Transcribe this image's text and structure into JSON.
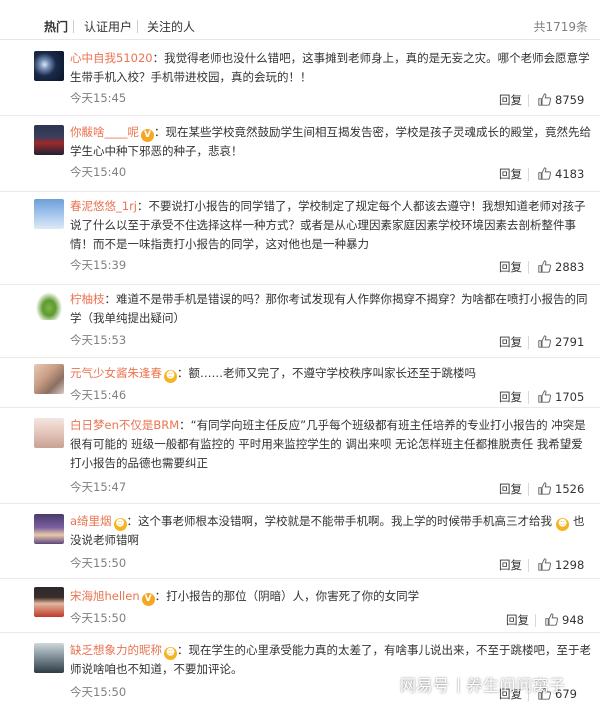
{
  "tabs": [
    {
      "label": "热门"
    },
    {
      "label": "认证用户"
    },
    {
      "label": "关注的人"
    }
  ],
  "total_label": "共1719条",
  "reply_label": "回复",
  "comments": [
    {
      "user": "心中自我51020",
      "text": "：我觉得老师也没什么错吧，这事摊到老师身上，真的是无妄之灾。哪个老师会愿意学生带手机入校？手机带进校园，真的会玩的！！",
      "time": "今天15:45",
      "likes": "8759"
    },
    {
      "user": "你黻啥____呢",
      "text": "：现在某些学校竟然鼓励学生间相互揭发告密，学校是孩子灵魂成长的殿堂，竟然先给学生心中种下邪恶的种子，悲哀！",
      "time": "今天15:40",
      "likes": "4183"
    },
    {
      "user": "春泥悠悠_1rj",
      "text": "：不要说打小报告的同学错了，学校制定了规定每个人都该去遵守！我想知道老师对孩子说了什么以至于承受不住选择这样一种方式？或者是从心理因素家庭因素学校环境因素去剖析整件事情！而不是一味指责打小报告的同学，这对他也是一种暴力",
      "time": "今天15:39",
      "likes": "2883"
    },
    {
      "user": "柠柚枝",
      "text": "：难道不是带手机是错误的吗？那你考试发现有人作弊你揭穿不揭穿？为啥都在喷打小报告的同学（我单纯提出疑问）",
      "time": "今天15:53",
      "likes": "2791"
    },
    {
      "user": "元气少女酱朱逢春",
      "text": "：额……老师又完了，不遵守学校秩序叫家长还至于跳楼吗",
      "time": "今天15:46",
      "likes": "1705"
    },
    {
      "user": "白日梦en不仅是BRM",
      "text": "：“有同学向班主任反应”几乎每个班级都有班主任培养的专业打小报告的 冲突是很有可能的 班级一般都有监控的 平时用来监控学生的 调出来呗 无论怎样班主任都推脱责任 我希望爱打小报告的品德也需要纠正",
      "time": "今天15:47",
      "likes": "1526"
    },
    {
      "user": "a绮里烟",
      "text": "：这个事老师根本没错啊，学校就是不能带手机啊。我上学的时候带手机高三才给我",
      "text2": "也没说老师错啊",
      "time": "今天15:50",
      "likes": "1298"
    },
    {
      "user": "宋海旭hellen",
      "text": "：打小报告的那位（阴暗）人，你害死了你的女同学",
      "time": "今天15:50",
      "likes": "948"
    },
    {
      "user": "缺乏想象力的昵称",
      "text": "：现在学生的心里承受能力真的太差了，有啥事儿说出来，不至于跳楼吧，至于老师说啥咱也不知道，不要加评论。",
      "time": "今天15:50",
      "likes": "679"
    }
  ],
  "watermark": {
    "brand": "网易号",
    "account": "养生问问窝子"
  },
  "colors": {
    "username": "#eb7350",
    "muted": "#808080",
    "divider": "#eaeaea",
    "badge": "#f5a623"
  },
  "icons": [
    "thumbs-up-icon",
    "verified-v-badge-icon",
    "emoji-face-icon"
  ]
}
